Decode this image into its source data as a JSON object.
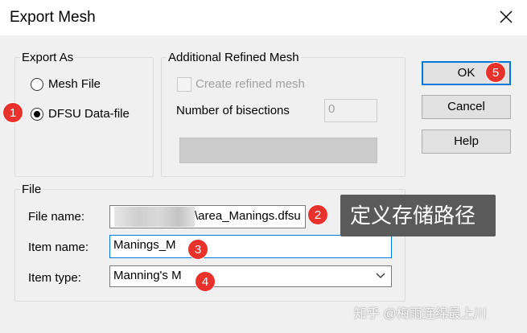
{
  "window": {
    "title": "Export Mesh"
  },
  "export_as": {
    "legend": "Export As",
    "options": [
      {
        "label": "Mesh File",
        "selected": false
      },
      {
        "label": "DFSU Data-file",
        "selected": true
      }
    ]
  },
  "refined": {
    "legend": "Additional Refined Mesh",
    "checkbox_label": "Create refined mesh",
    "bisections_label": "Number of bisections",
    "bisections_value": "0",
    "button_label": ""
  },
  "file": {
    "legend": "File",
    "file_name_label": "File name:",
    "file_name_value": "\\area_Manings.dfsu",
    "item_name_label": "Item name:",
    "item_name_value": "Manings_M",
    "item_type_label": "Item type:",
    "item_type_value": "Manning's M"
  },
  "buttons": {
    "ok": "OK",
    "cancel": "Cancel",
    "help": "Help"
  },
  "annotations": {
    "badge_1": "1",
    "badge_2": "2",
    "badge_3": "3",
    "badge_4": "4",
    "badge_5": "5",
    "tooltip": "定义存储路径",
    "watermark": "知乎 @梅雨连绵最上川"
  },
  "colors": {
    "badge": "#e8322b",
    "tooltip_bg": "#5a5a5a",
    "default_button_border": "#0078d7"
  }
}
